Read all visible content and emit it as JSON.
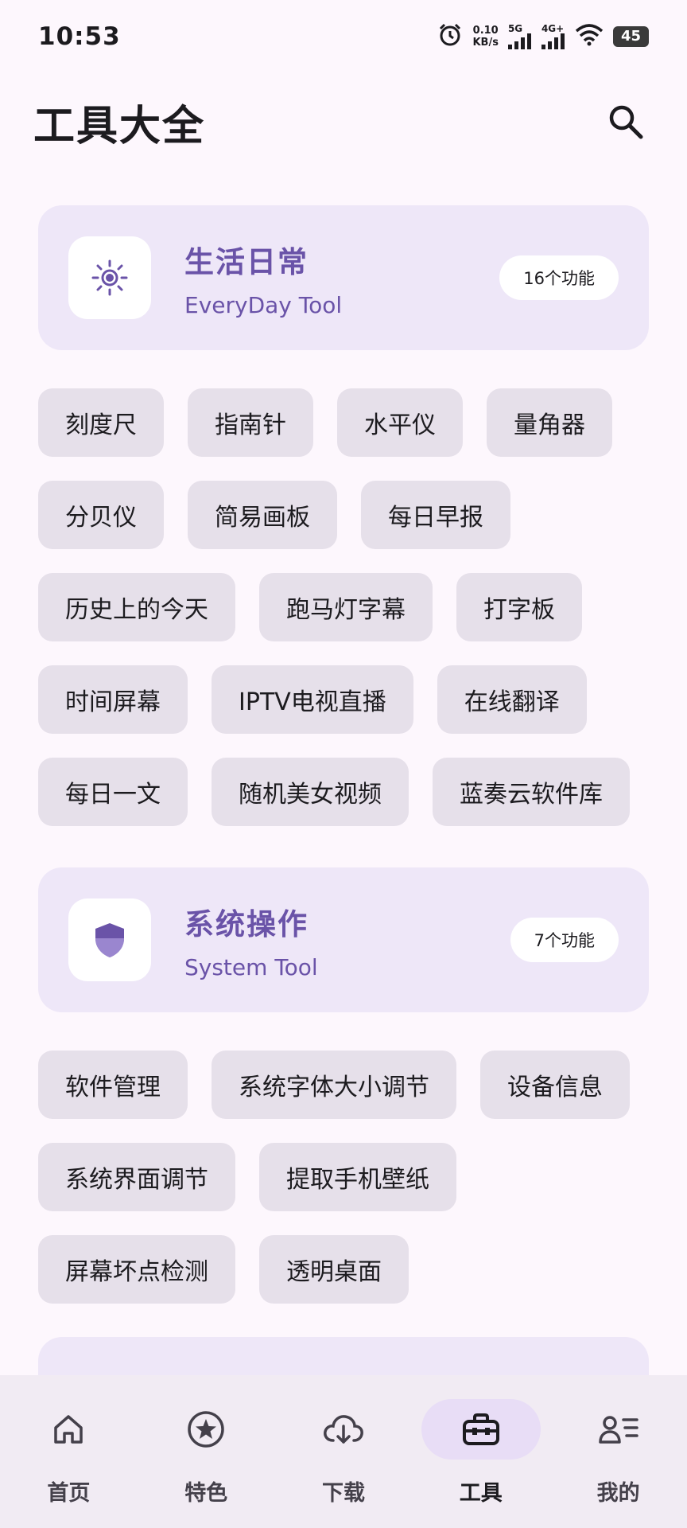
{
  "status_bar": {
    "time": "10:53",
    "net_speed_value": "0.10",
    "net_speed_unit": "KB/s",
    "signal_1": "5G",
    "signal_2": "4G+",
    "battery": "45"
  },
  "header": {
    "title": "工具大全",
    "search_icon": "search-icon"
  },
  "categories": [
    {
      "title": "生活日常",
      "subtitle": "EveryDay Tool",
      "count": "16个功能",
      "icon": "sun-icon",
      "tools": [
        "刻度尺",
        "指南针",
        "水平仪",
        "量角器",
        "分贝仪",
        "简易画板",
        "每日早报",
        "历史上的今天",
        "跑马灯字幕",
        "打字板",
        "时间屏幕",
        "IPTV电视直播",
        "在线翻译",
        "每日一文",
        "随机美女视频",
        "蓝奏云软件库"
      ]
    },
    {
      "title": "系统操作",
      "subtitle": "System Tool",
      "count": "7个功能",
      "icon": "shield-icon",
      "tools": [
        "软件管理",
        "系统字体大小调节",
        "设备信息",
        "系统界面调节",
        "提取手机壁纸",
        "屏幕坏点检测",
        "透明桌面"
      ]
    }
  ],
  "nav": [
    {
      "label": "首页",
      "icon": "home-icon",
      "active": false
    },
    {
      "label": "特色",
      "icon": "star-icon",
      "active": false
    },
    {
      "label": "下载",
      "icon": "cloud-download-icon",
      "active": false
    },
    {
      "label": "工具",
      "icon": "toolbox-icon",
      "active": true
    },
    {
      "label": "我的",
      "icon": "profile-list-icon",
      "active": false
    }
  ],
  "colors": {
    "accent": "#6a53a8",
    "card_bg": "#eee7f8",
    "chip_bg": "#e6e0ea",
    "page_bg": "#fdf7fd"
  }
}
